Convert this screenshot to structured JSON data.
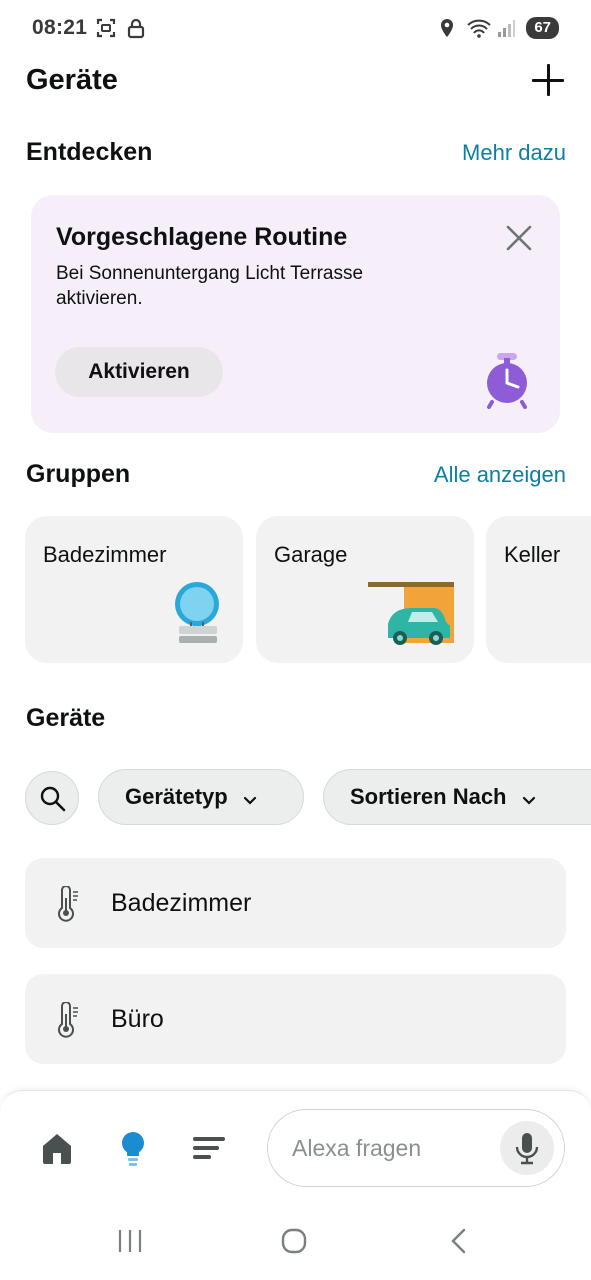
{
  "status_bar": {
    "time": "08:21",
    "battery": "67",
    "icons": [
      "screenshot-icon",
      "lock-icon",
      "location-icon",
      "wifi-icon",
      "signal-icon"
    ]
  },
  "header": {
    "title": "Geräte",
    "add_icon": "plus-icon"
  },
  "discover": {
    "title": "Entdecken",
    "link": "Mehr dazu"
  },
  "suggestion": {
    "title": "Vorgeschlagene Routine",
    "text": "Bei Sonnenuntergang Licht Terrasse aktivieren.",
    "button": "Aktivieren",
    "close_icon": "close-icon",
    "illustration": "alarm-clock-icon",
    "bg_color": "#f6effa",
    "accent_color": "#8d5cd6"
  },
  "groups": {
    "title": "Gruppen",
    "link": "Alle anzeigen",
    "items": [
      {
        "name": "Badezimmer",
        "icon": "bulb-illustration"
      },
      {
        "name": "Garage",
        "icon": "garage-car-illustration"
      },
      {
        "name": "Keller",
        "icon": ""
      }
    ]
  },
  "devices": {
    "title": "Geräte",
    "filters": {
      "search_icon": "search-icon",
      "type_label": "Gerätetyp",
      "sort_label": "Sortieren Nach"
    },
    "items": [
      {
        "name": "Badezimmer",
        "icon": "thermometer-icon"
      },
      {
        "name": "Büro",
        "icon": "thermometer-icon"
      }
    ]
  },
  "bottom_bar": {
    "nav": [
      "home-icon",
      "devices-bulb-icon",
      "menu-icon"
    ],
    "active": "devices-bulb-icon",
    "active_color": "#1a8ccf",
    "alexa_placeholder": "Alexa fragen",
    "mic_icon": "microphone-icon"
  },
  "link_color": "#0b7fa6"
}
